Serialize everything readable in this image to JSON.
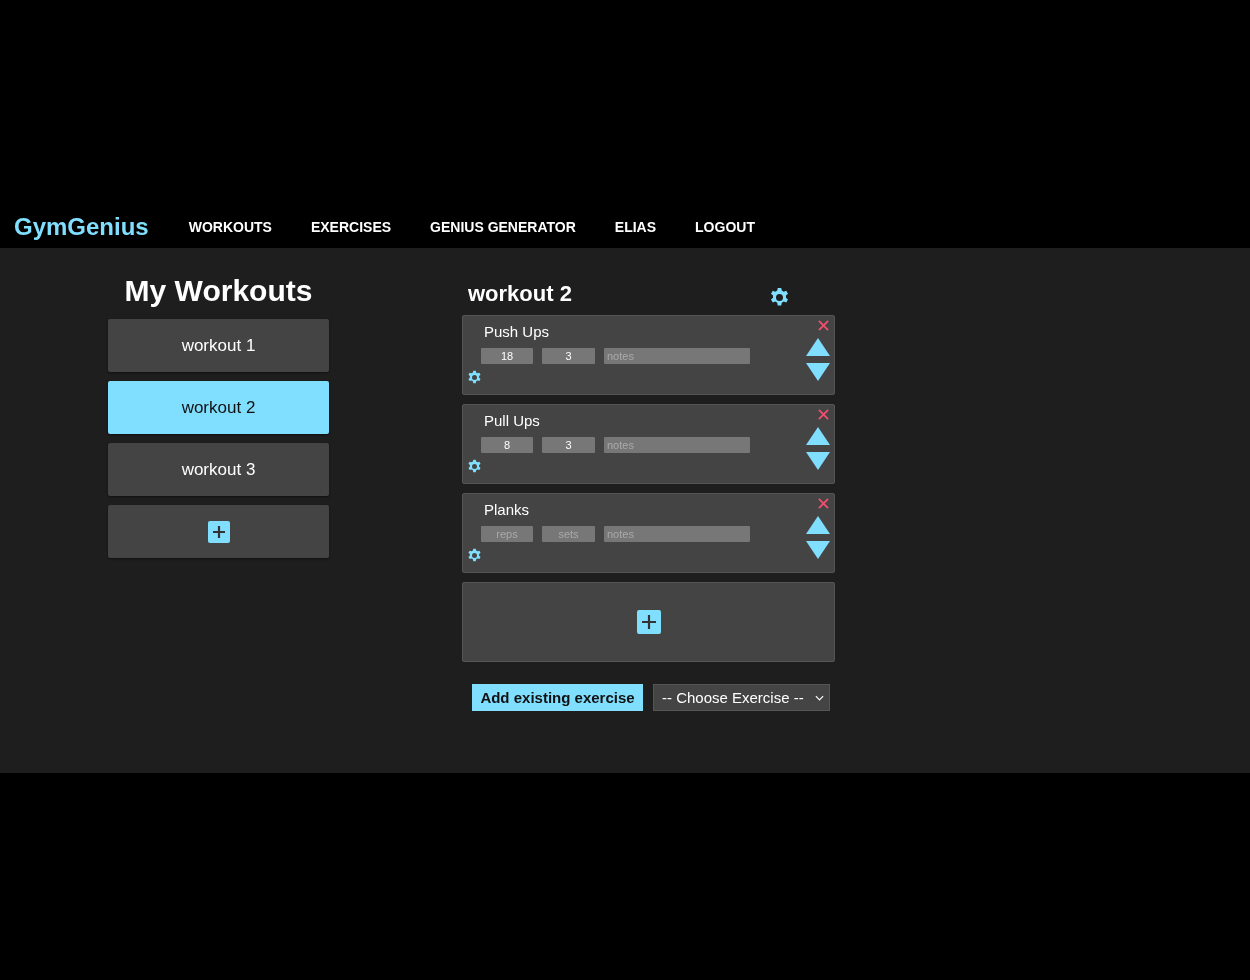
{
  "nav": {
    "logo": "GymGenius",
    "links": [
      {
        "label": "WORKOUTS"
      },
      {
        "label": "EXERCISES"
      },
      {
        "label": "GENIUS GENERATOR"
      },
      {
        "label": "ELIAS"
      },
      {
        "label": "LOGOUT"
      }
    ]
  },
  "sidebar": {
    "title": "My Workouts",
    "items": [
      {
        "label": "workout 1",
        "selected": false
      },
      {
        "label": "workout 2",
        "selected": true
      },
      {
        "label": "workout 3",
        "selected": false
      }
    ]
  },
  "workout": {
    "title": "workout 2",
    "exercises": [
      {
        "name": "Push Ups",
        "fields": [
          {
            "kind": "reps",
            "value": "18"
          },
          {
            "kind": "sets",
            "value": "3"
          },
          {
            "kind": "notes",
            "placeholder": "notes"
          }
        ]
      },
      {
        "name": "Pull Ups",
        "fields": [
          {
            "kind": "reps",
            "value": "8"
          },
          {
            "kind": "sets",
            "value": "3"
          },
          {
            "kind": "notes",
            "placeholder": "notes"
          }
        ]
      },
      {
        "name": "Planks",
        "fields": [
          {
            "kind": "reps",
            "placeholder": "reps"
          },
          {
            "kind": "sets",
            "placeholder": "sets"
          },
          {
            "kind": "notes",
            "placeholder": "notes"
          }
        ]
      }
    ]
  },
  "add_existing": {
    "button": "Add existing exercise",
    "select": "-- Choose Exercise --"
  }
}
